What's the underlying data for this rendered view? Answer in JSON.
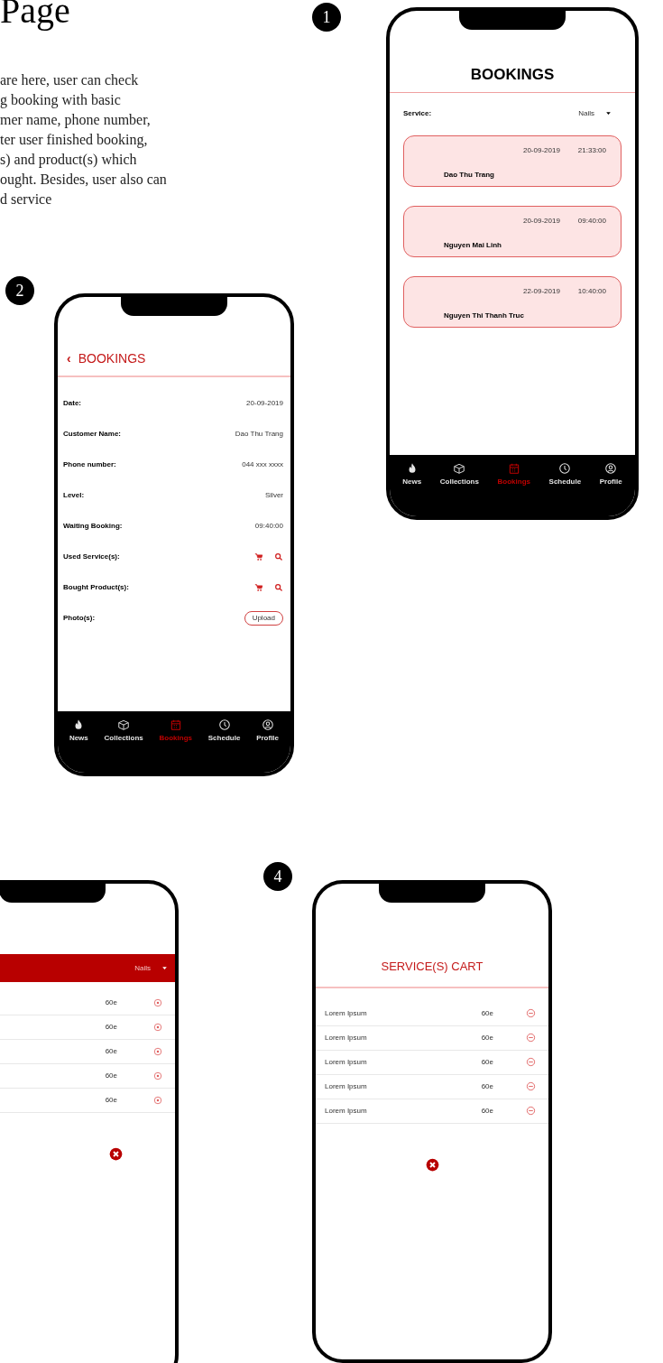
{
  "page": {
    "heading": "Page",
    "description": "are here, user can check\ng booking with basic\nmer name, phone number,\nter user finished booking,\ns) and product(s) which\nought. Besides, user also can\nd service"
  },
  "screens": [
    {
      "kind": "bookings_list",
      "badge": "1",
      "title": "BOOKINGS",
      "filter": {
        "label": "Service:",
        "value": "Nails"
      },
      "bookings": [
        {
          "date": "20-09-2019",
          "time": "21:33:00",
          "name": "Dao Thu Trang"
        },
        {
          "date": "20-09-2019",
          "time": "09:40:00",
          "name": "Nguyen Mai Linh"
        },
        {
          "date": "22-09-2019",
          "time": "10:40:00",
          "name": "Nguyen Thi Thanh Truc"
        }
      ],
      "nav": [
        {
          "label": "News",
          "selected": false
        },
        {
          "label": "Collections",
          "selected": false
        },
        {
          "label": "Bookings",
          "selected": true
        },
        {
          "label": "Schedule",
          "selected": false
        },
        {
          "label": "Profile",
          "selected": false
        }
      ]
    },
    {
      "kind": "booking_detail",
      "badge": "2",
      "back": "‹",
      "title": "BOOKINGS",
      "fields": [
        {
          "kind": "text",
          "label": "Date:",
          "value": "20-09-2019"
        },
        {
          "kind": "text",
          "label": "Customer Name:",
          "value": "Dao Thu Trang"
        },
        {
          "kind": "text",
          "label": "Phone number:",
          "value": "044 xxx xxxx"
        },
        {
          "kind": "text",
          "label": "Level:",
          "value": "Silver"
        },
        {
          "kind": "text",
          "label": "Waiting Booking:",
          "value": "09:40:00"
        },
        {
          "kind": "actions",
          "label": "Used Service(s):"
        },
        {
          "kind": "actions",
          "label": "Bought Product(s):"
        },
        {
          "kind": "upload",
          "label": "Photo(s):",
          "button": "Upload"
        }
      ],
      "nav": [
        {
          "label": "News",
          "selected": false
        },
        {
          "label": "Collections",
          "selected": false
        },
        {
          "label": "Bookings",
          "selected": true
        },
        {
          "label": "Schedule",
          "selected": false
        },
        {
          "label": "Profile",
          "selected": false
        }
      ]
    },
    {
      "kind": "service_picker",
      "filter": {
        "value": "Nails"
      },
      "items": [
        {
          "price": "60e"
        },
        {
          "price": "60e"
        },
        {
          "price": "60e"
        },
        {
          "price": "60e"
        },
        {
          "price": "60e"
        }
      ]
    },
    {
      "kind": "service_cart",
      "badge": "4",
      "title": "SERVICE(S) CART",
      "items": [
        {
          "name": "Lorem Ipsum",
          "price": "60e"
        },
        {
          "name": "Lorem Ipsum",
          "price": "60e"
        },
        {
          "name": "Lorem Ipsum",
          "price": "60e"
        },
        {
          "name": "Lorem Ipsum",
          "price": "60e"
        },
        {
          "name": "Lorem Ipsum",
          "price": "60e"
        }
      ]
    }
  ]
}
